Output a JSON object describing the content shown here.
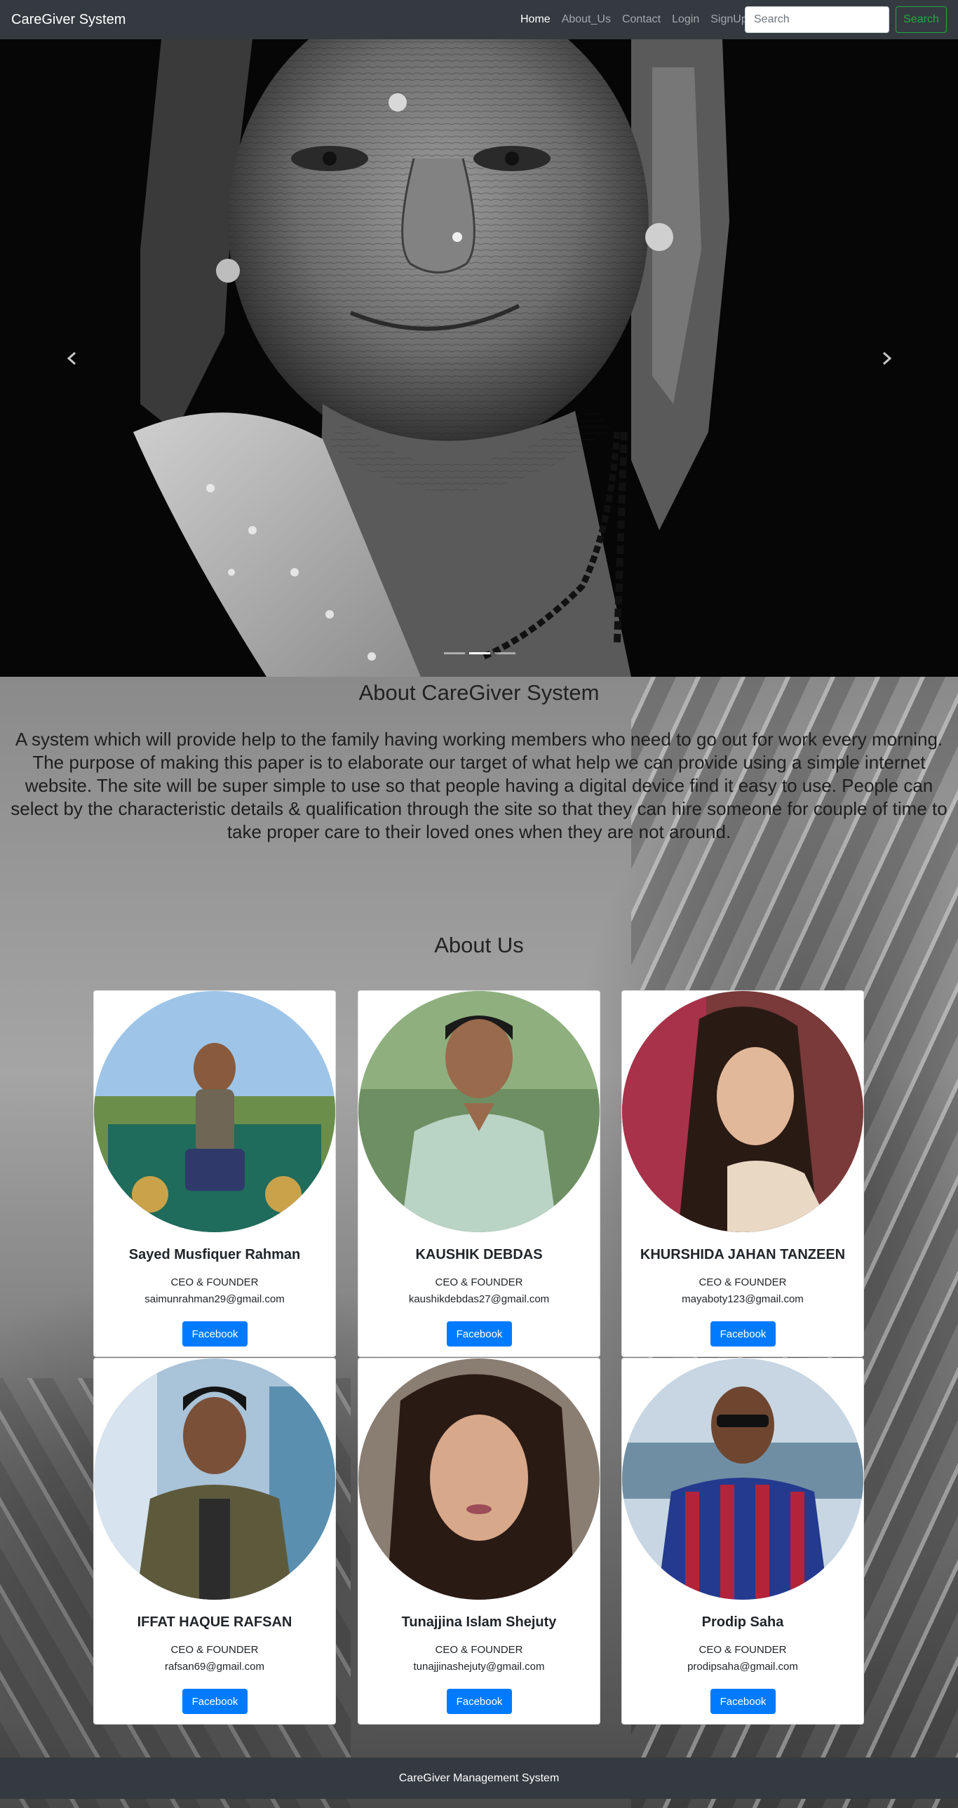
{
  "navbar": {
    "brand": "CareGiver System",
    "links": [
      {
        "label": "Home"
      },
      {
        "label": "About_Us"
      },
      {
        "label": "Contact"
      },
      {
        "label": "Login"
      },
      {
        "label": "SignUp"
      }
    ],
    "search_placeholder": "Search",
    "search_button": "Search"
  },
  "carousel": {
    "slides_count": 3,
    "active_slide": 1
  },
  "about": {
    "title": "About CareGiver System",
    "text": "A system which will provide help to the family having working members who need to go out for work every morning. The purpose of making this paper is to elaborate our target of what help we can provide using a simple internet website. The site will be super simple to use so that people having a digital device find it easy to use. People can select by the characteristic details & qualification through the site so that they can hire someone for couple of time to take proper care to their loved ones when they are not around."
  },
  "team": {
    "title": "About Us",
    "members": [
      {
        "name": "Sayed Musfiquer Rahman",
        "role": "CEO & FOUNDER",
        "email": "saimunrahman29@gmail.com",
        "button": "Facebook"
      },
      {
        "name": "KAUSHIK DEBDAS",
        "role": "CEO & FOUNDER",
        "email": "kaushikdebdas27@gmail.com",
        "button": "Facebook"
      },
      {
        "name": "KHURSHIDA JAHAN TANZEEN",
        "role": "CEO & FOUNDER",
        "email": "mayaboty123@gmail.com",
        "button": "Facebook"
      },
      {
        "name": "IFFAT HAQUE RAFSAN",
        "role": "CEO & FOUNDER",
        "email": "rafsan69@gmail.com",
        "button": "Facebook"
      },
      {
        "name": "Tunajjina Islam Shejuty",
        "role": "CEO & FOUNDER",
        "email": "tunajjinashejuty@gmail.com",
        "button": "Facebook"
      },
      {
        "name": "Prodip Saha",
        "role": "CEO & FOUNDER",
        "email": "prodipsaha@gmail.com",
        "button": "Facebook"
      }
    ]
  },
  "footer": {
    "text": "CareGiver Management System"
  },
  "colors": {
    "navbar_bg": "#343a40",
    "primary": "#007bff",
    "success": "#28a745"
  }
}
